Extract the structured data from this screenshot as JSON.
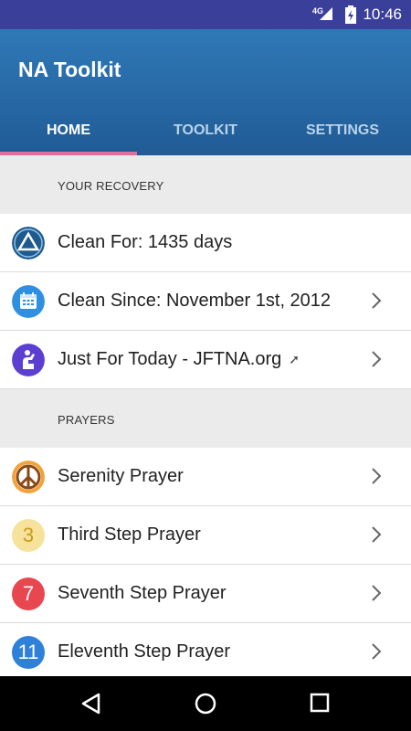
{
  "status_bar": {
    "network": "4G",
    "time": "10:46"
  },
  "app": {
    "title": "NA Toolkit"
  },
  "tabs": [
    {
      "label": "HOME",
      "active": true
    },
    {
      "label": "TOOLKIT",
      "active": false
    },
    {
      "label": "SETTINGS",
      "active": false
    }
  ],
  "sections": {
    "recovery": {
      "header": "YOUR RECOVERY",
      "items": [
        {
          "label": "Clean For: 1435 days",
          "icon": "na-triangle-icon"
        },
        {
          "label": "Clean Since: November 1st, 2012",
          "icon": "calendar-icon"
        },
        {
          "label": "Just For Today - JFTNA.org",
          "icon": "praying-figure-icon",
          "external_glyph": "➚"
        }
      ]
    },
    "prayers": {
      "header": "PRAYERS",
      "items": [
        {
          "label": "Serenity Prayer",
          "icon": "peace-sign-icon"
        },
        {
          "label": "Third Step Prayer",
          "icon": "number-3-icon",
          "badge": "3"
        },
        {
          "label": "Seventh Step Prayer",
          "icon": "number-7-icon",
          "badge": "7"
        },
        {
          "label": "Eleventh Step Prayer",
          "icon": "number-11-icon",
          "badge": "11"
        }
      ]
    }
  },
  "colors": {
    "status_bar": "#3a3f9a",
    "app_bar": "#2f79b7",
    "tab_indicator": "#e06f9f"
  }
}
